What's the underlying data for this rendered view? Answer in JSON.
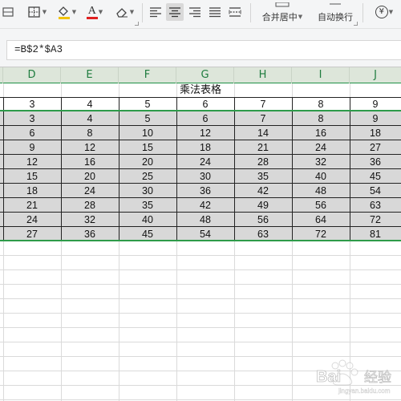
{
  "toolbar": {
    "merge_center_label": "合并居中",
    "wrap_text_label": "自动换行",
    "currency_icon": "¥",
    "font_color_letter": "A",
    "font_color": "#e02020"
  },
  "formula_bar": {
    "value": "=B$2*$A3"
  },
  "columns": [
    "D",
    "E",
    "F",
    "G",
    "H",
    "I",
    "J"
  ],
  "sheet": {
    "title": "乘法表格",
    "header_row": [
      "3",
      "4",
      "5",
      "6",
      "7",
      "8",
      "9"
    ],
    "rows": [
      [
        "3",
        "4",
        "5",
        "6",
        "7",
        "8",
        "9"
      ],
      [
        "6",
        "8",
        "10",
        "12",
        "14",
        "16",
        "18"
      ],
      [
        "9",
        "12",
        "15",
        "18",
        "21",
        "24",
        "27"
      ],
      [
        "12",
        "16",
        "20",
        "24",
        "28",
        "32",
        "36"
      ],
      [
        "15",
        "20",
        "25",
        "30",
        "35",
        "40",
        "45"
      ],
      [
        "18",
        "24",
        "30",
        "36",
        "42",
        "48",
        "54"
      ],
      [
        "21",
        "28",
        "35",
        "42",
        "49",
        "56",
        "63"
      ],
      [
        "24",
        "32",
        "40",
        "48",
        "56",
        "64",
        "72"
      ],
      [
        "27",
        "36",
        "45",
        "54",
        "63",
        "72",
        "81"
      ]
    ]
  },
  "colors": {
    "selection": "#2e9b4a",
    "header_letters": "#1e7c3e",
    "selected_fill": "#d8d8d8"
  }
}
